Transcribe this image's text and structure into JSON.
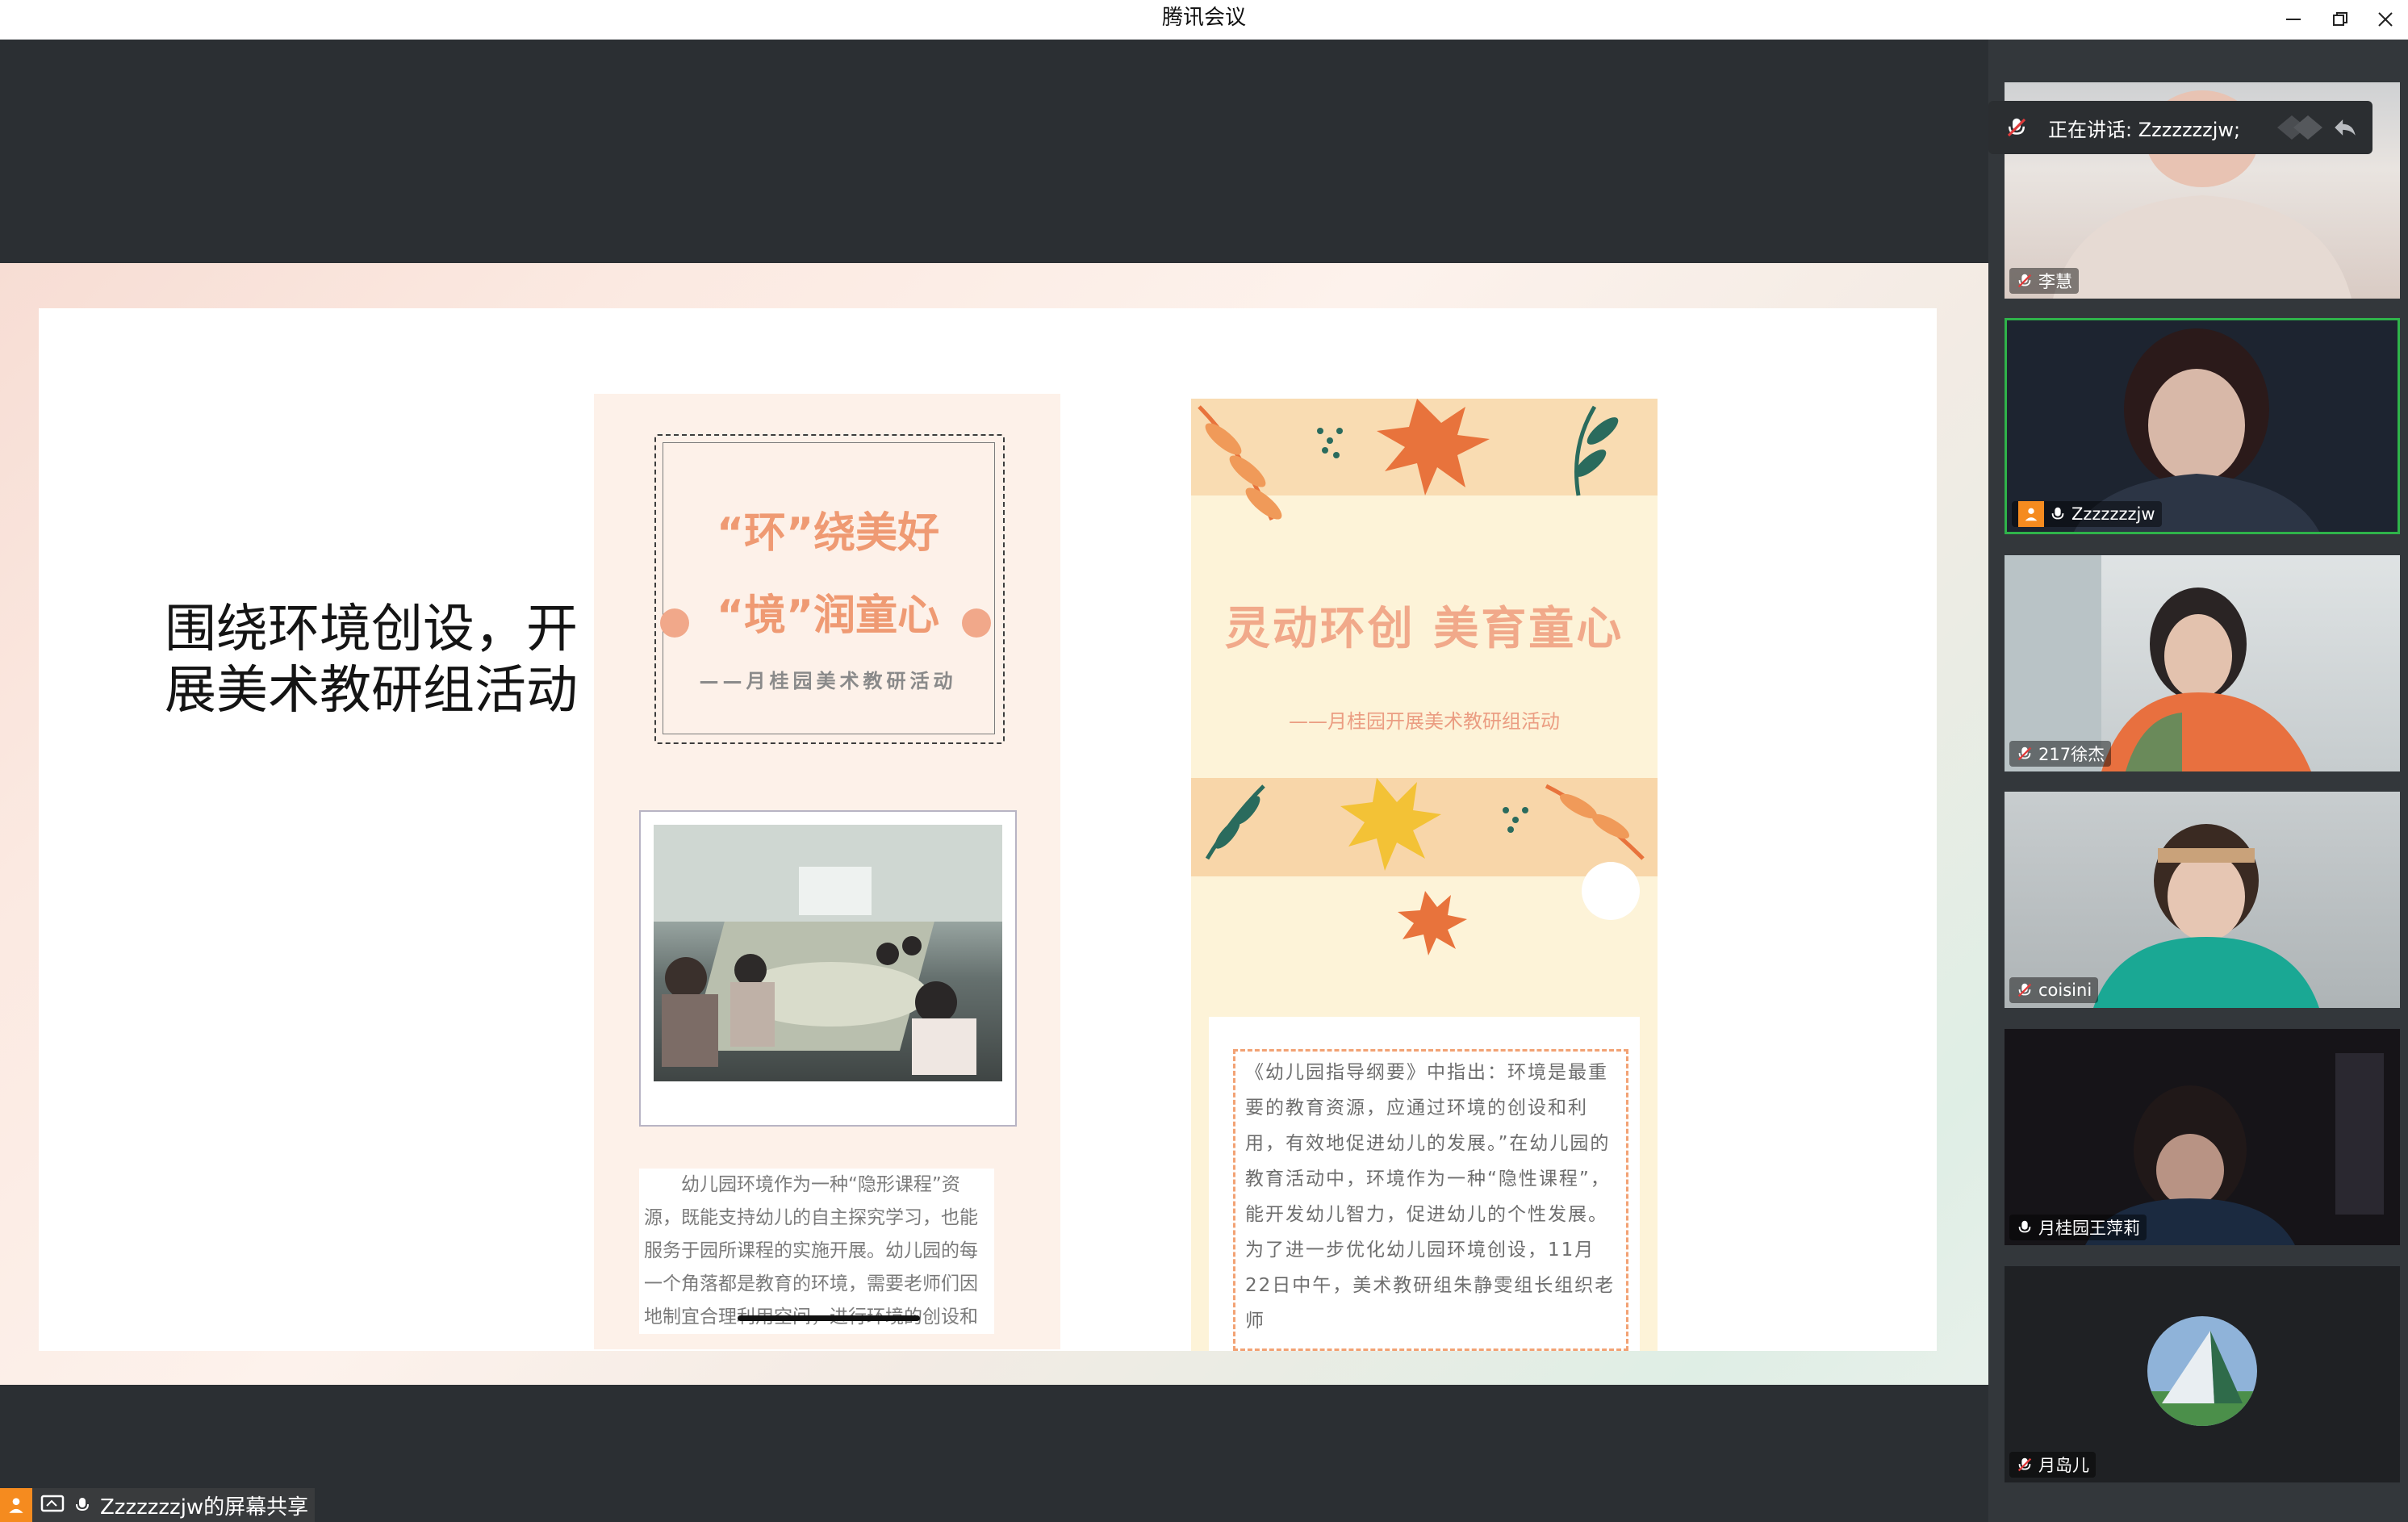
{
  "window": {
    "title": "腾讯会议"
  },
  "slide": {
    "heading_line1": "围绕环境创设，开",
    "heading_line2": "展美术教研组活动",
    "poster_left": {
      "title_line1": "“环”绕美好",
      "title_line2": "“境”润童心",
      "subtitle": "——月桂园美术教研活动",
      "body": "幼儿园环境作为一种“隐形课程”资源，既能支持幼儿的自主探究学习，也能服务于园所课程的实施开展。幼儿园的每一个角落都是教育的环境，需要老师们因地制宜合理利用空间，进行环境的创设和"
    },
    "poster_right": {
      "title": "灵动环创 美育童心",
      "subtitle": "——月桂园开展美术教研组活动",
      "body": "《幼儿园指导纲要》中指出：环境是最重要的教育资源，应通过环境的创设和利用，有效地促进幼儿的发展。”在幼儿园的教育活动中，环境作为一种“隐性课程”，能开发幼儿智力，促进幼儿的个性发展。为了进一步优化幼儿园环境创设，11月22日中午，美术教研组朱静雯组长组织老师"
    }
  },
  "speaking": {
    "label": "正在讲话: Zzzzzzzjw;"
  },
  "participants": [
    {
      "name": "李慧",
      "muted": true
    },
    {
      "name": "Zzzzzzzjw",
      "muted": false,
      "host": true
    },
    {
      "name": "217徐杰",
      "muted": true
    },
    {
      "name": "coisini",
      "muted": true
    },
    {
      "name": "月桂园王萍莉",
      "muted": false
    },
    {
      "name": "月岛儿",
      "muted": true
    }
  ],
  "share_bar": {
    "label": "Zzzzzzzjw的屏幕共享"
  },
  "colors": {
    "accent_orange": "#f58b1f",
    "active_border": "#2fb34a",
    "muted_red": "#e03b3b"
  }
}
